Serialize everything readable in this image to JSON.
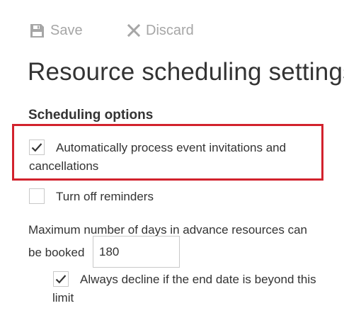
{
  "toolbar": {
    "save_label": "Save",
    "discard_label": "Discard"
  },
  "page": {
    "title": "Resource scheduling settings"
  },
  "scheduling": {
    "heading": "Scheduling options",
    "auto_process": {
      "label": "Automatically process event invitations and cancellations",
      "checked": true
    },
    "turn_off_reminders": {
      "label": "Turn off reminders",
      "checked": false
    },
    "max_days": {
      "label_line1": "Maximum number of days in advance resources can",
      "label_line2": "be booked",
      "value": "180"
    },
    "always_decline": {
      "label": "Always decline if the end date is beyond this limit",
      "checked": true
    }
  },
  "colors": {
    "highlight": "#d2222d",
    "toolbar_text": "#a6a6a6",
    "text": "#333333"
  },
  "icons": {
    "save": "floppy-disk-icon",
    "discard": "x-icon",
    "check": "checkmark-icon"
  }
}
